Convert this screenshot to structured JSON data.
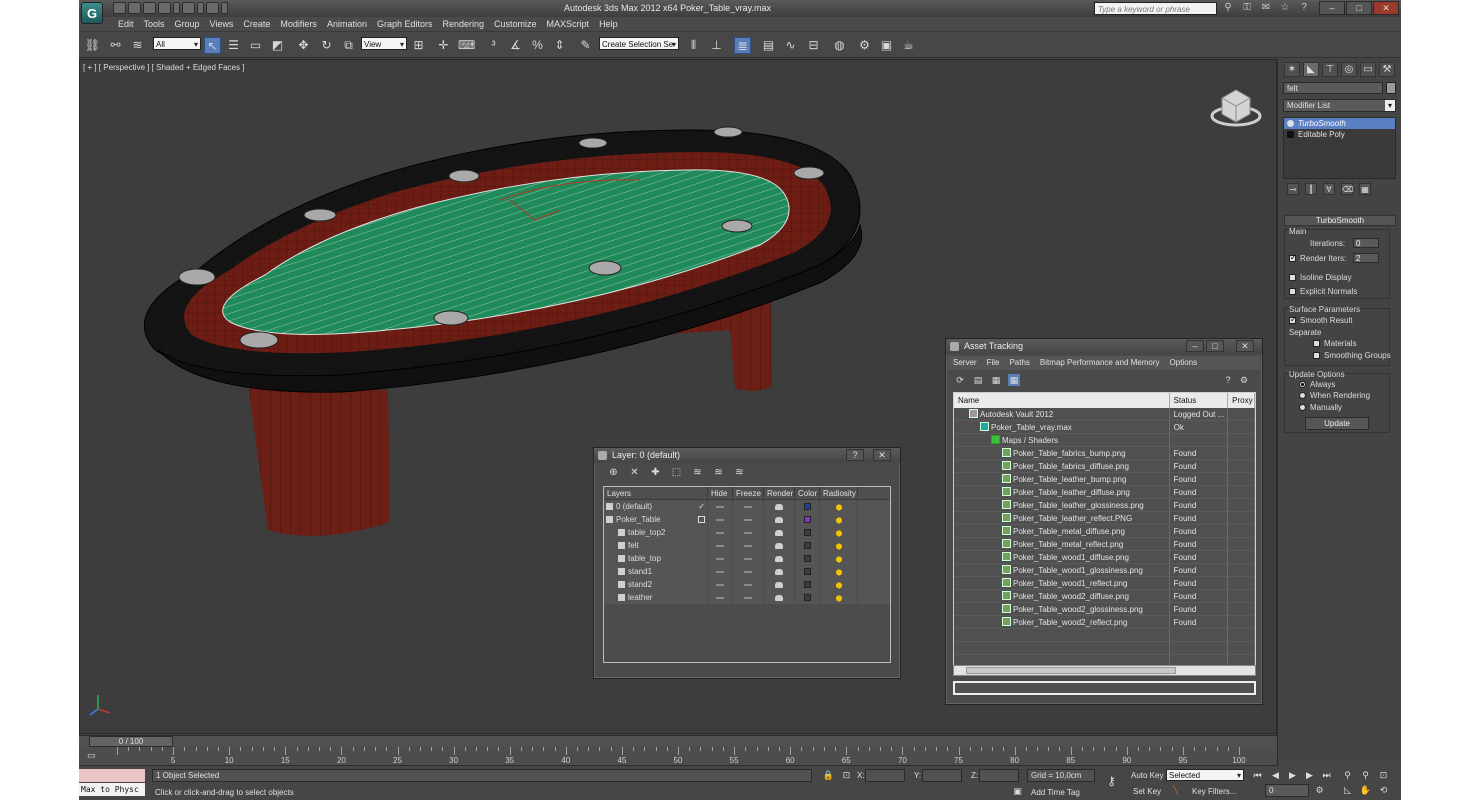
{
  "window": {
    "app_title": "Autodesk 3ds Max 2012 x64      Poker_Table_vray.max",
    "search_placeholder": "Type a keyword or phrase",
    "logo_letter": "G"
  },
  "menu": [
    "Edit",
    "Tools",
    "Group",
    "Views",
    "Create",
    "Modifiers",
    "Animation",
    "Graph Editors",
    "Rendering",
    "Customize",
    "MAXScript",
    "Help"
  ],
  "toolbar": {
    "selection_filter": "All",
    "ref_coord": "View",
    "named_selection": "Create Selection Se"
  },
  "viewport": {
    "label": "[ + ] [ Perspective ] [ Shaded + Edged Faces ]"
  },
  "command_panel": {
    "object_name": "felt",
    "modifier_list": "Modifier List",
    "stack": [
      "TurboSmooth",
      "Editable Poly"
    ],
    "rollout_title": "TurboSmooth",
    "main_group": "Main",
    "iterations_label": "Iterations:",
    "iterations_value": "0",
    "render_iters_label": "Render Iters:",
    "render_iters_value": "2",
    "isoline_display": "Isoline Display",
    "explicit_normals": "Explicit Normals",
    "surface_params": "Surface Parameters",
    "smooth_result": "Smooth Result",
    "separate": "Separate",
    "materials": "Materials",
    "smoothing_groups": "Smoothing Groups",
    "update_options": "Update Options",
    "always": "Always",
    "when_rendering": "When Rendering",
    "manually": "Manually",
    "update_button": "Update"
  },
  "layer_explorer": {
    "title": "Layer: 0 (default)",
    "help": "?",
    "close": "✕",
    "columns": [
      "Layers",
      "Hide",
      "Freeze",
      "Render",
      "Color",
      "Radiosity"
    ],
    "rows": [
      {
        "name": "0 (default)",
        "indent": 0,
        "color": "#1f3f9a"
      },
      {
        "name": "Poker_Table",
        "indent": 0,
        "color": "#7b38c9"
      },
      {
        "name": "table_top2",
        "indent": 1,
        "color": "#3d3d3d"
      },
      {
        "name": "felt",
        "indent": 1,
        "color": "#3d3d3d"
      },
      {
        "name": "table_top",
        "indent": 1,
        "color": "#3d3d3d"
      },
      {
        "name": "stand1",
        "indent": 1,
        "color": "#3d3d3d"
      },
      {
        "name": "stand2",
        "indent": 1,
        "color": "#3d3d3d"
      },
      {
        "name": "leather",
        "indent": 1,
        "color": "#3d3d3d"
      }
    ]
  },
  "asset_tracking": {
    "title": "Asset Tracking",
    "menu": [
      "Server",
      "File",
      "Paths",
      "Bitmap Performance and Memory",
      "Options"
    ],
    "columns": [
      "Name",
      "Status",
      "Proxy"
    ],
    "rows": [
      {
        "name": "Autodesk Vault 2012",
        "status": "Logged Out ...",
        "indent": 1
      },
      {
        "name": "Poker_Table_vray.max",
        "status": "Ok",
        "indent": 2
      },
      {
        "name": "Maps / Shaders",
        "status": "",
        "indent": 3
      },
      {
        "name": "Poker_Table_fabrics_bump.png",
        "status": "Found",
        "indent": 4
      },
      {
        "name": "Poker_Table_fabrics_diffuse.png",
        "status": "Found",
        "indent": 4
      },
      {
        "name": "Poker_Table_leather_bump.png",
        "status": "Found",
        "indent": 4
      },
      {
        "name": "Poker_Table_leather_diffuse.png",
        "status": "Found",
        "indent": 4
      },
      {
        "name": "Poker_Table_leather_glossiness.png",
        "status": "Found",
        "indent": 4
      },
      {
        "name": "Poker_Table_leather_reflect.PNG",
        "status": "Found",
        "indent": 4
      },
      {
        "name": "Poker_Table_metal_diffuse.png",
        "status": "Found",
        "indent": 4
      },
      {
        "name": "Poker_Table_metal_reflect.png",
        "status": "Found",
        "indent": 4
      },
      {
        "name": "Poker_Table_wood1_diffuse.png",
        "status": "Found",
        "indent": 4
      },
      {
        "name": "Poker_Table_wood1_glossiness.png",
        "status": "Found",
        "indent": 4
      },
      {
        "name": "Poker_Table_wood1_reflect.png",
        "status": "Found",
        "indent": 4
      },
      {
        "name": "Poker_Table_wood2_diffuse.png",
        "status": "Found",
        "indent": 4
      },
      {
        "name": "Poker_Table_wood2_glossiness.png",
        "status": "Found",
        "indent": 4
      },
      {
        "name": "Poker_Table_wood2_reflect.png",
        "status": "Found",
        "indent": 4
      }
    ]
  },
  "timeline": {
    "frame_readout": "0 / 100",
    "tick_labels": [
      "5",
      "10",
      "15",
      "20",
      "25",
      "30",
      "35",
      "40",
      "45",
      "50",
      "55",
      "60",
      "65",
      "70",
      "75",
      "80",
      "85",
      "90",
      "95",
      "100"
    ]
  },
  "statusbar": {
    "listener_text": "Max to Physc",
    "selection_status": "1 Object Selected",
    "prompt": "Click or click-and-drag to select objects",
    "x_label": "X:",
    "y_label": "Y:",
    "z_label": "Z:",
    "grid": "Grid = 10,0cm",
    "add_time_tag": "Add Time Tag",
    "auto_key": "Auto Key",
    "auto_key_mode": "Selected",
    "set_key": "Set Key",
    "key_filters": "Key Filters...",
    "current_frame": "0"
  },
  "colors": {
    "felt": "#1f8a5a",
    "wood": "#6e1d14",
    "rail": "#141414",
    "selection_blue": "#5b7fc3"
  }
}
